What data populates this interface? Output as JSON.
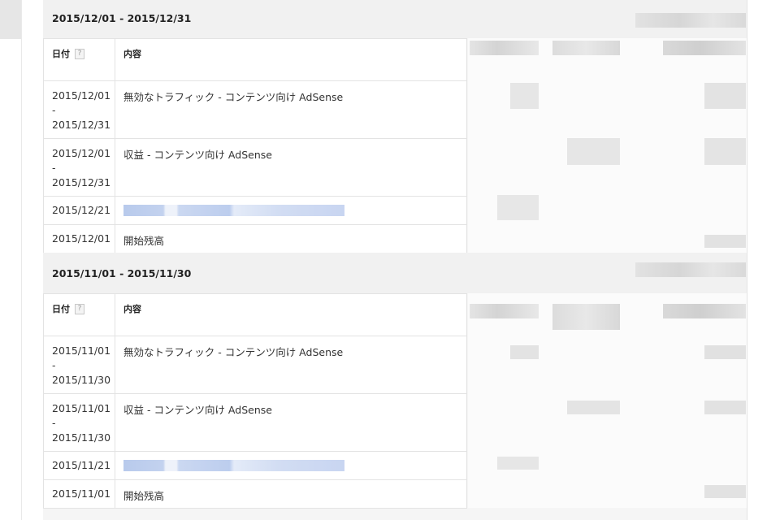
{
  "columns": {
    "date": "日付",
    "description": "内容",
    "help_icon": "?"
  },
  "periods": [
    {
      "title": "2015/12/01 - 2015/12/31",
      "rows": [
        {
          "date_lines": [
            "2015/12/01",
            "-",
            "2015/12/31"
          ],
          "description": "無効なトラフィック - コンテンツ向け AdSense"
        },
        {
          "date_lines": [
            "2015/12/01",
            "-",
            "2015/12/31"
          ],
          "description": "収益 - コンテンツ向け AdSense"
        },
        {
          "date_lines": [
            "2015/12/21"
          ],
          "description": ""
        },
        {
          "date_lines": [
            "2015/12/01"
          ],
          "description": "開始残高"
        }
      ]
    },
    {
      "title": "2015/11/01 - 2015/11/30",
      "rows": [
        {
          "date_lines": [
            "2015/11/01",
            "-",
            "2015/11/30"
          ],
          "description": "無効なトラフィック - コンテンツ向け AdSense"
        },
        {
          "date_lines": [
            "2015/11/01",
            "-",
            "2015/11/30"
          ],
          "description": "収益 - コンテンツ向け AdSense"
        },
        {
          "date_lines": [
            "2015/11/21"
          ],
          "description": ""
        },
        {
          "date_lines": [
            "2015/11/01"
          ],
          "description": "開始残高"
        }
      ]
    }
  ],
  "colors": {
    "redaction_blue": "#c6d4ef",
    "redaction_gray": "#dedede"
  }
}
